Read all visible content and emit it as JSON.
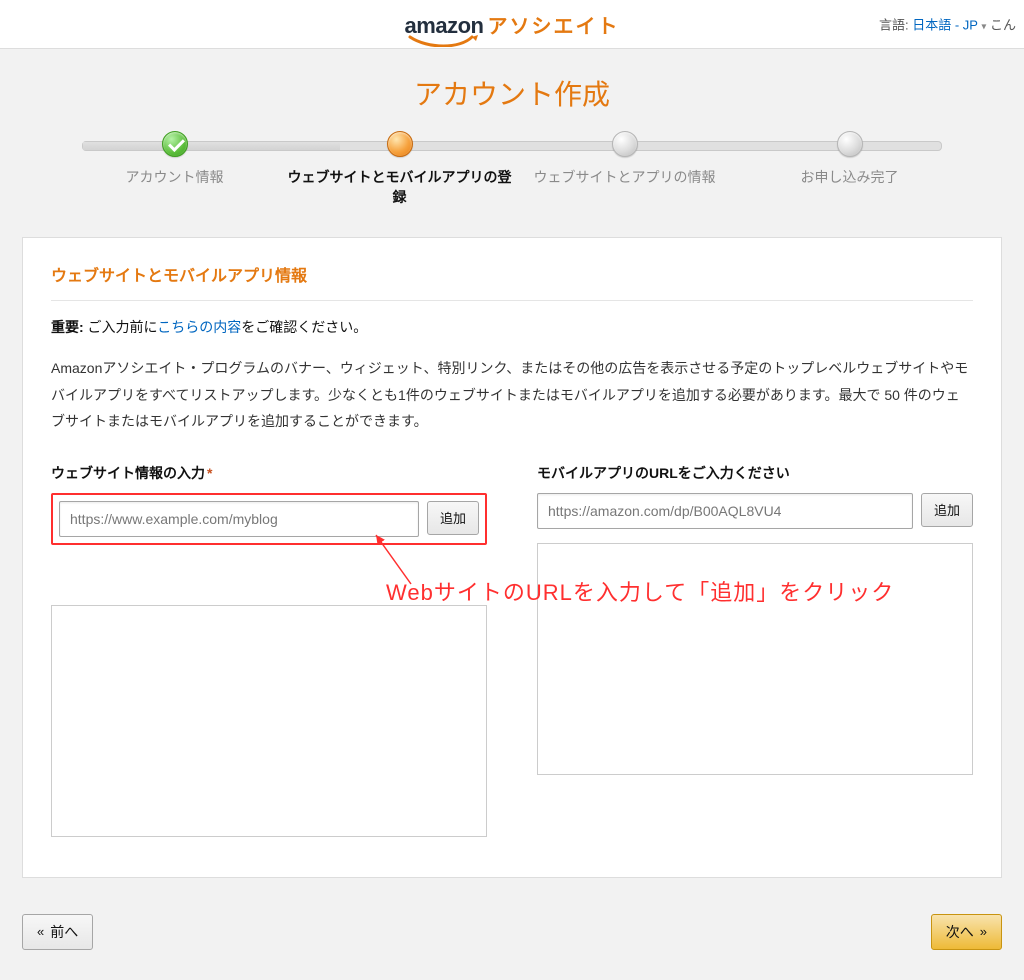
{
  "topbar": {
    "brand_main": "amazon",
    "brand_sub": "アソシエイト",
    "lang_label": "言語:",
    "lang_value": "日本語 - JP",
    "greeting": "こん"
  },
  "page": {
    "title": "アカウント作成"
  },
  "steps": {
    "s1": "アカウント情報",
    "s2": "ウェブサイトとモバイルアプリの登録",
    "s3": "ウェブサイトとアプリの情報",
    "s4": "お申し込み完了"
  },
  "section": {
    "heading": "ウェブサイトとモバイルアプリ情報",
    "notice_bold": "重要:",
    "notice_pre": " ご入力前に",
    "notice_link": "こちらの内容",
    "notice_post": "をご確認ください。",
    "description": "Amazonアソシエイト・プログラムのバナー、ウィジェット、特別リンク、またはその他の広告を表示させる予定のトップレベルウェブサイトやモバイルアプリをすべてリストアップします。少なくとも1件のウェブサイトまたはモバイルアプリを追加する必要があります。最大で 50 件のウェブサイトまたはモバイルアプリを追加することができます。"
  },
  "fields": {
    "website_label": "ウェブサイト情報の入力",
    "website_placeholder": "https://www.example.com/myblog",
    "website_add": "追加",
    "app_label": "モバイルアプリのURLをご入力ください",
    "app_placeholder": "https://amazon.com/dp/B00AQL8VU4",
    "app_add": "追加"
  },
  "annotation": {
    "text": "WebサイトのURLを入力して「追加」をクリック"
  },
  "nav": {
    "prev": "前へ",
    "next": "次へ"
  }
}
